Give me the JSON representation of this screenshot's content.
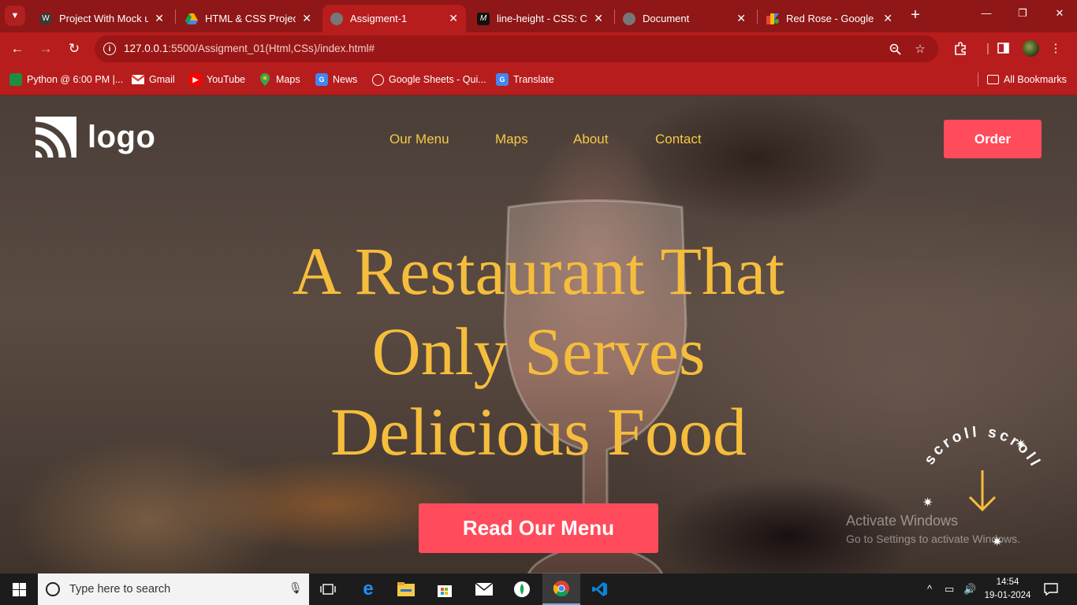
{
  "browser": {
    "tabs": [
      {
        "title": "Project With Mock up",
        "icon": "wordpress-icon",
        "color": "#ffffff"
      },
      {
        "title": "HTML & CSS Project",
        "icon": "google-drive-icon",
        "color": "#f4b400"
      },
      {
        "title": "Assigment-1",
        "icon": "globe-icon",
        "color": "#888888",
        "active": true
      },
      {
        "title": "line-height - CSS: Cas",
        "icon": "mdn-icon",
        "color": "#000000"
      },
      {
        "title": "Document",
        "icon": "globe-icon",
        "color": "#888888"
      },
      {
        "title": "Red Rose - Google Fo",
        "icon": "google-fonts-icon",
        "color": "#ea4335"
      }
    ],
    "address": {
      "host": "127.0.0.1",
      "path": ":5500/Assigment_01(Html,CSs)/index.html#"
    },
    "bookmarks": [
      {
        "label": "Python @ 6:00 PM |...",
        "icon": "classroom-icon",
        "color": "#1e8e3e"
      },
      {
        "label": "Gmail",
        "icon": "gmail-icon",
        "color": "#ea4335"
      },
      {
        "label": "YouTube",
        "icon": "youtube-icon",
        "color": "#ff0000"
      },
      {
        "label": "Maps",
        "icon": "maps-icon",
        "color": "#34a853"
      },
      {
        "label": "News",
        "icon": "news-icon",
        "color": "#4285f4"
      },
      {
        "label": "Google Sheets - Qui...",
        "icon": "globe-icon",
        "color": "#ffffff"
      },
      {
        "label": "Translate",
        "icon": "translate-icon",
        "color": "#4285f4"
      }
    ],
    "all_bookmarks": "All Bookmarks"
  },
  "site": {
    "logo_text": "logo",
    "nav": [
      "Our Menu",
      "Maps",
      "About",
      "Contact"
    ],
    "order_button": "Order",
    "hero_lines": [
      "A Restaurant That",
      "Only Serves",
      "Delicious Food"
    ],
    "cta_button": "Read Our Menu",
    "scroll_badge_text": "scroll scroll",
    "colors": {
      "accent": "#ff4b5c",
      "heading": "#f6bd3d",
      "nav": "#f6c946"
    }
  },
  "watermark": {
    "line1": "Activate Windows",
    "line2": "Go to Settings to activate Windows."
  },
  "taskbar": {
    "search_placeholder": "Type here to search",
    "time": "14:54",
    "date": "19-01-2024"
  }
}
